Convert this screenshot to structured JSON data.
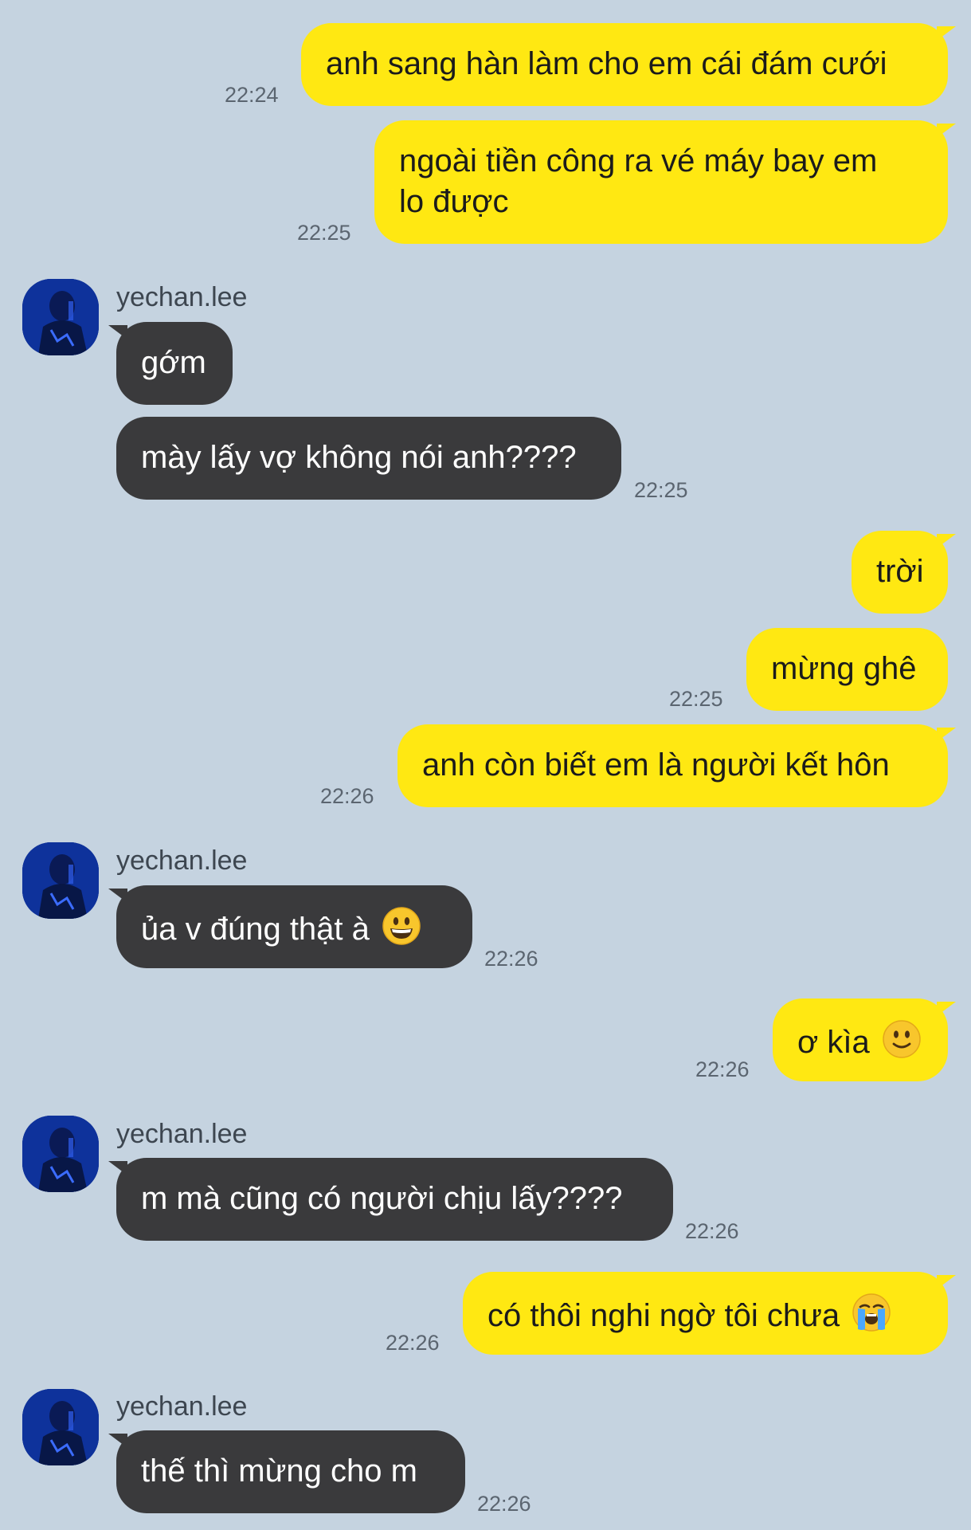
{
  "colors": {
    "background": "#c5d3e0",
    "outgoing_bubble": "#ffe812",
    "incoming_bubble": "#3a3a3c",
    "timestamp": "#5b6570"
  },
  "messages": [
    {
      "direction": "out",
      "text": "anh sang hàn làm cho em cái đám cưới",
      "time": "22:24"
    },
    {
      "direction": "out",
      "lines": [
        "ngoài tiền công ra vé máy bay em",
        "lo được"
      ],
      "time": "22:25"
    },
    {
      "direction": "in",
      "sender": "yechan.lee",
      "text": "gớm"
    },
    {
      "direction": "in",
      "text": "mày lấy vợ không nói anh????",
      "time": "22:25"
    },
    {
      "direction": "out",
      "text": "trời"
    },
    {
      "direction": "out",
      "text": "mừng ghê",
      "time": "22:25"
    },
    {
      "direction": "out",
      "text": "anh còn biết em là người kết hôn",
      "time": "22:26"
    },
    {
      "direction": "in",
      "sender": "yechan.lee",
      "text": "ủa v đúng thật à",
      "emoji": "grinning-face-emoji",
      "time": "22:26"
    },
    {
      "direction": "out",
      "text": "ơ kìa",
      "emoji": "slightly-smiling-face-emoji",
      "time": "22:26"
    },
    {
      "direction": "in",
      "sender": "yechan.lee",
      "text": "m mà cũng có người chịu lấy????",
      "time": "22:26"
    },
    {
      "direction": "out",
      "text": "có thôi nghi ngờ tôi chưa",
      "emoji": "loudly-crying-face-emoji",
      "time": "22:26"
    },
    {
      "direction": "in",
      "sender": "yechan.lee",
      "text": "thế thì mừng cho m",
      "time": "22:26"
    }
  ]
}
